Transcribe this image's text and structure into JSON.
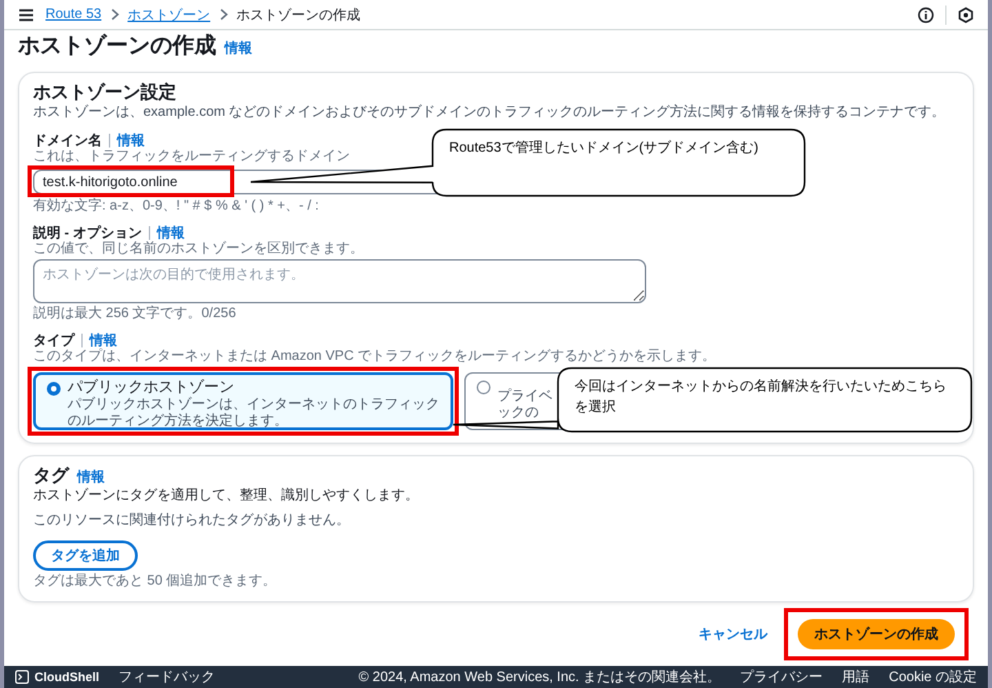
{
  "topbar": {
    "breadcrumbs": [
      {
        "label": "Route 53",
        "link": true
      },
      {
        "label": "ホストゾーン",
        "link": true
      },
      {
        "label": "ホストゾーンの作成",
        "link": false
      }
    ]
  },
  "page": {
    "title": "ホストゾーンの作成",
    "info": "情報"
  },
  "settings": {
    "heading": "ホストゾーン設定",
    "description": "ホストゾーンは、example.com などのドメインおよびそのサブドメインのトラフィックのルーティング方法に関する情報を保持するコンテナです。",
    "domain": {
      "label": "ドメイン名",
      "info": "情報",
      "hint": "これは、トラフィックをルーティングするドメイン",
      "value": "test.k-hitorigoto.online",
      "constraint": "有効な文字: a-z、0-9、! \" # $ % & ' ( ) * +、- / :"
    },
    "comment": {
      "label": "説明 - オプション",
      "info": "情報",
      "hint": "この値で、同じ名前のホストゾーンを区別できます。",
      "placeholder": "ホストゾーンは次の目的で使用されます。",
      "counter": "説明は最大 256 文字です。0/256"
    },
    "type": {
      "label": "タイプ",
      "info": "情報",
      "hint": "このタイプは、インターネットまたは Amazon VPC でトラフィックをルーティングするかどうかを示します。",
      "options": [
        {
          "label": "パブリックホストゾーン",
          "description_lines": [
            "パブリックホストゾーンは、インターネットのトラフィック",
            "のルーティング方法を決定します。"
          ],
          "selected": true
        },
        {
          "description_lines": [
            "プライベ",
            "ックの"
          ],
          "selected": false
        }
      ]
    }
  },
  "tags": {
    "heading": "タグ",
    "info": "情報",
    "description": "ホストゾーンにタグを適用して、整理、識別しやすくします。",
    "empty": "このリソースに関連付けられたタグがありません。",
    "add_button": "タグを追加",
    "limit": "タグは最大であと 50 個追加できます。"
  },
  "actions": {
    "cancel": "キャンセル",
    "create": "ホストゾーンの作成"
  },
  "footer": {
    "cloudshell": "CloudShell",
    "feedback": "フィードバック",
    "copyright": "© 2024, Amazon Web Services, Inc. またはその関連会社。",
    "links": [
      "プライバシー",
      "用語",
      "Cookie の設定"
    ]
  },
  "annotations": [
    {
      "kind": "callout",
      "text": "Route53で管理したいドメイン(サブドメイン含む)"
    },
    {
      "kind": "callout",
      "text": "今回はインターネットからの名前解決を行いたいためこちらを選択"
    }
  ]
}
